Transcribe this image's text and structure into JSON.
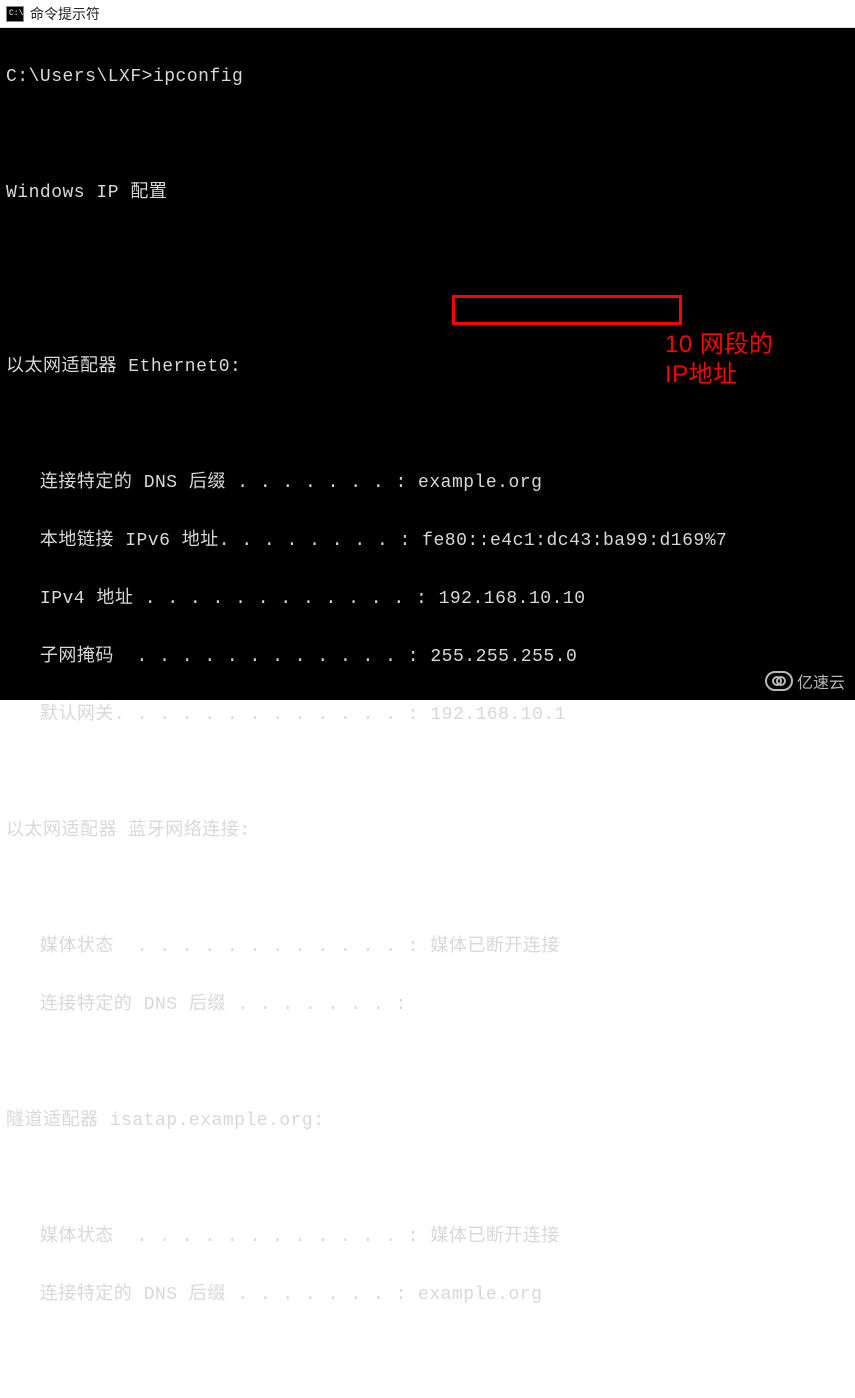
{
  "window": {
    "title": "命令提示符",
    "icon_label": "C:\\."
  },
  "terminal": {
    "prompt": "C:\\Users\\LXF>",
    "command": "ipconfig",
    "header": "Windows IP 配置",
    "adapters": [
      {
        "title": "以太网适配器 Ethernet0:",
        "rows": [
          {
            "label": "   连接特定的 DNS 后缀 . . . . . . . :",
            "value": " example.org"
          },
          {
            "label": "   本地链接 IPv6 地址. . . . . . . . :",
            "value": " fe80::e4c1:dc43:ba99:d169%7"
          },
          {
            "label": "   IPv4 地址 . . . . . . . . . . . . :",
            "value": " 192.168.10.10"
          },
          {
            "label": "   子网掩码  . . . . . . . . . . . . :",
            "value": " 255.255.255.0"
          },
          {
            "label": "   默认网关. . . . . . . . . . . . . :",
            "value": " 192.168.10.1"
          }
        ]
      },
      {
        "title": "以太网适配器 蓝牙网络连接:",
        "rows": [
          {
            "label": "   媒体状态  . . . . . . . . . . . . :",
            "value": " 媒体已断开连接"
          },
          {
            "label": "   连接特定的 DNS 后缀 . . . . . . . :",
            "value": ""
          }
        ]
      },
      {
        "title": "隧道适配器 isatap.example.org:",
        "rows": [
          {
            "label": "   媒体状态  . . . . . . . . . . . . :",
            "value": " 媒体已断开连接"
          },
          {
            "label": "   连接特定的 DNS 后缀 . . . . . . . :",
            "value": " example.org"
          }
        ]
      }
    ]
  },
  "annotation": {
    "line1": "10 网段的",
    "line2": "IP地址"
  },
  "watermark": {
    "text": "亿速云"
  },
  "colors": {
    "terminal_bg": "#000000",
    "terminal_fg": "#d8d8d8",
    "highlight": "#ff0000"
  }
}
